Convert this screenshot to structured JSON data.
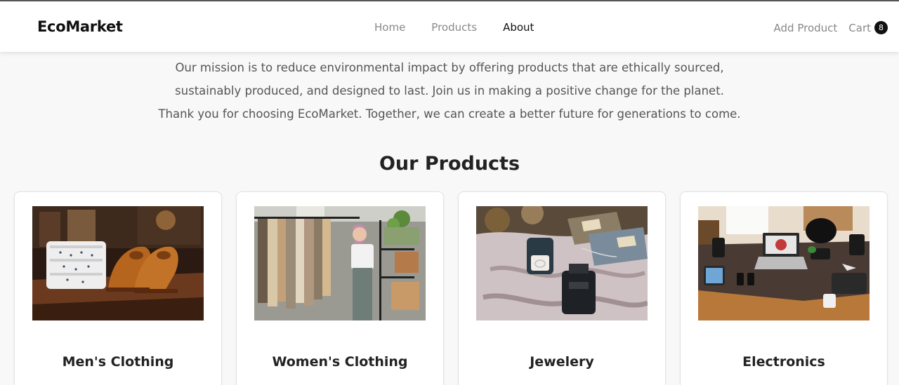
{
  "header": {
    "brand": "EcoMarket",
    "nav": [
      {
        "label": "Home"
      },
      {
        "label": "Products"
      },
      {
        "label": "About"
      }
    ],
    "add_product": "Add Product",
    "cart_label": "Cart",
    "cart_count": "8"
  },
  "mission": {
    "line1": "Our mission is to reduce environmental impact by offering products that are ethically sourced,",
    "line2": "sustainably produced, and designed to last. Join us in making a positive change for the planet.",
    "line3": "Thank you for choosing EcoMarket. Together, we can create a better future for generations to come."
  },
  "products_section": {
    "title": "Our Products",
    "categories": [
      {
        "name": "Men's Clothing",
        "image": "shoes-and-shirts-photo"
      },
      {
        "name": "Women's Clothing",
        "image": "clothing-rack-shopper-photo"
      },
      {
        "name": "Jewelery",
        "image": "ring-and-perfume-photo"
      },
      {
        "name": "Electronics",
        "image": "desk-laptop-gadgets-photo"
      }
    ]
  },
  "colors": {
    "background": "#f8f8f8",
    "header_bg": "#ffffff",
    "text_dark": "#222222",
    "text_muted": "#888888",
    "badge": "#111111"
  }
}
